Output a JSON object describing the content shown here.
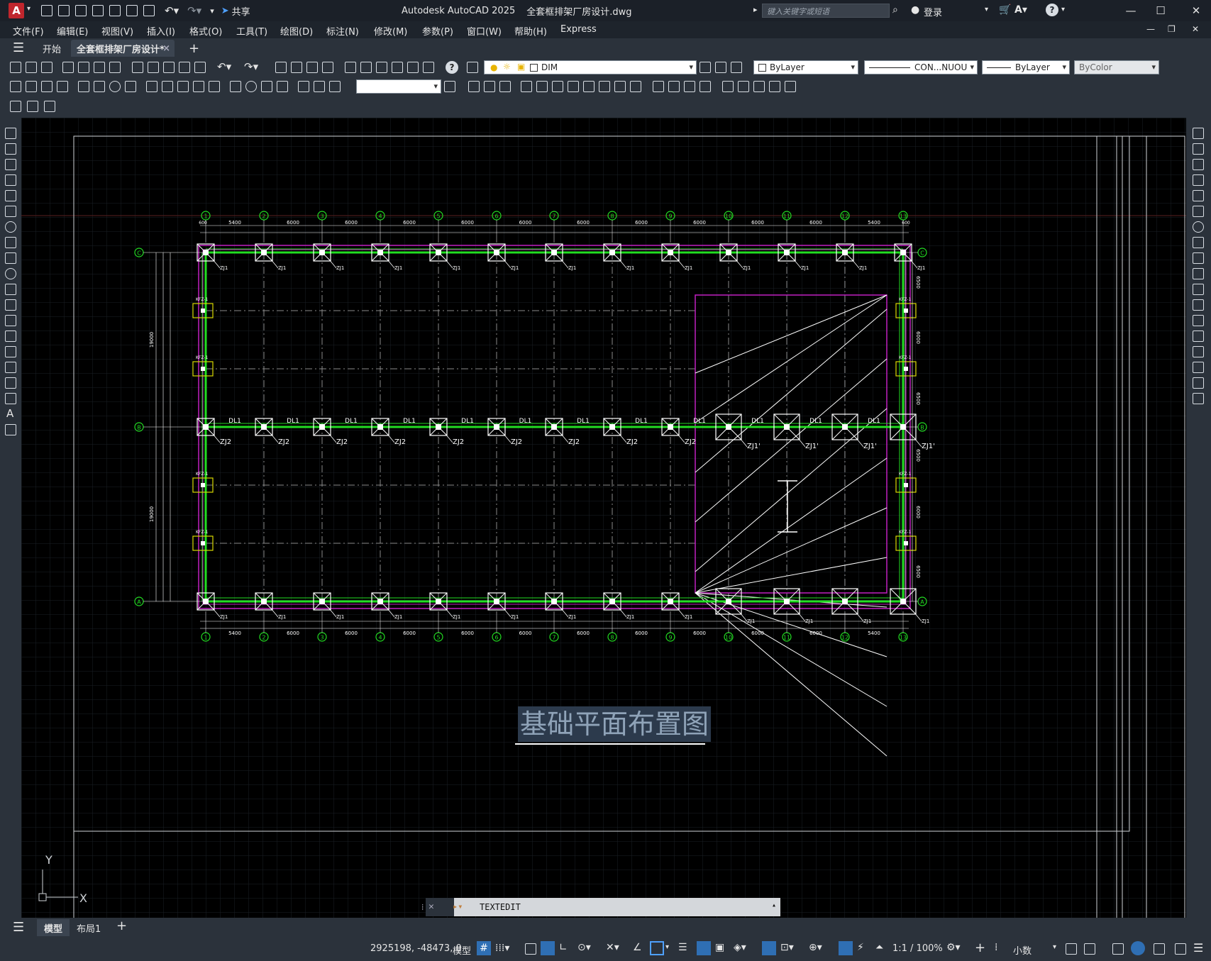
{
  "app": {
    "logo": "A",
    "share_label": "共享",
    "title": "Autodesk AutoCAD 2025",
    "filename": "全套框排架厂房设计.dwg",
    "search_placeholder": "键入关键字或短语",
    "login_label": "登录"
  },
  "menu": [
    "文件(F)",
    "编辑(E)",
    "视图(V)",
    "插入(I)",
    "格式(O)",
    "工具(T)",
    "绘图(D)",
    "标注(N)",
    "修改(M)",
    "参数(P)",
    "窗口(W)",
    "帮助(H)",
    "Express"
  ],
  "tabs": {
    "start": "开始",
    "active": "全套框排架厂房设计*",
    "close": "×",
    "add": "+"
  },
  "toolbar": {
    "layer_value": "DIM",
    "color_value": "ByLayer",
    "linetype_value": "CON...NUOU",
    "lineweight_value": "ByLayer",
    "plotstyle_value": "ByColor"
  },
  "drawing": {
    "title": "基础平面布置图",
    "grid_numbers": [
      "1",
      "2",
      "3",
      "4",
      "5",
      "6",
      "7",
      "8",
      "9",
      "10",
      "11",
      "12",
      "13"
    ],
    "grid_letters": [
      "C",
      "B",
      "A"
    ],
    "spans_top": [
      "5400",
      "6000",
      "6000",
      "6000",
      "6000",
      "6000",
      "6000",
      "6000",
      "6000",
      "6000",
      "6000",
      "5400"
    ],
    "spans_bottom": [
      "5400",
      "6000",
      "6000",
      "6000",
      "6000",
      "6000",
      "6000",
      "6000",
      "6000",
      "6000",
      "6000",
      "5400"
    ],
    "edge_dim": "600",
    "beam_label": "DL1",
    "footing_label_b": "ZJ2",
    "footing_label_b_alt": "ZJ1'",
    "footing_label_ac": "ZJ1",
    "column_label": "KFZ-1",
    "left_dims": [
      "19000",
      "19000"
    ],
    "right_dims": [
      "6500",
      "6000",
      "6500",
      "6500",
      "6000",
      "6500"
    ],
    "ucs_x": "X",
    "ucs_y": "Y"
  },
  "command": {
    "text": "TEXTEDIT"
  },
  "layout_tabs": {
    "model": "模型",
    "layout1": "布局1",
    "add": "+"
  },
  "status": {
    "coords": "2925198, -48473, 0",
    "mode": "模型",
    "scale": "1:1 / 100%",
    "units": "小数"
  }
}
